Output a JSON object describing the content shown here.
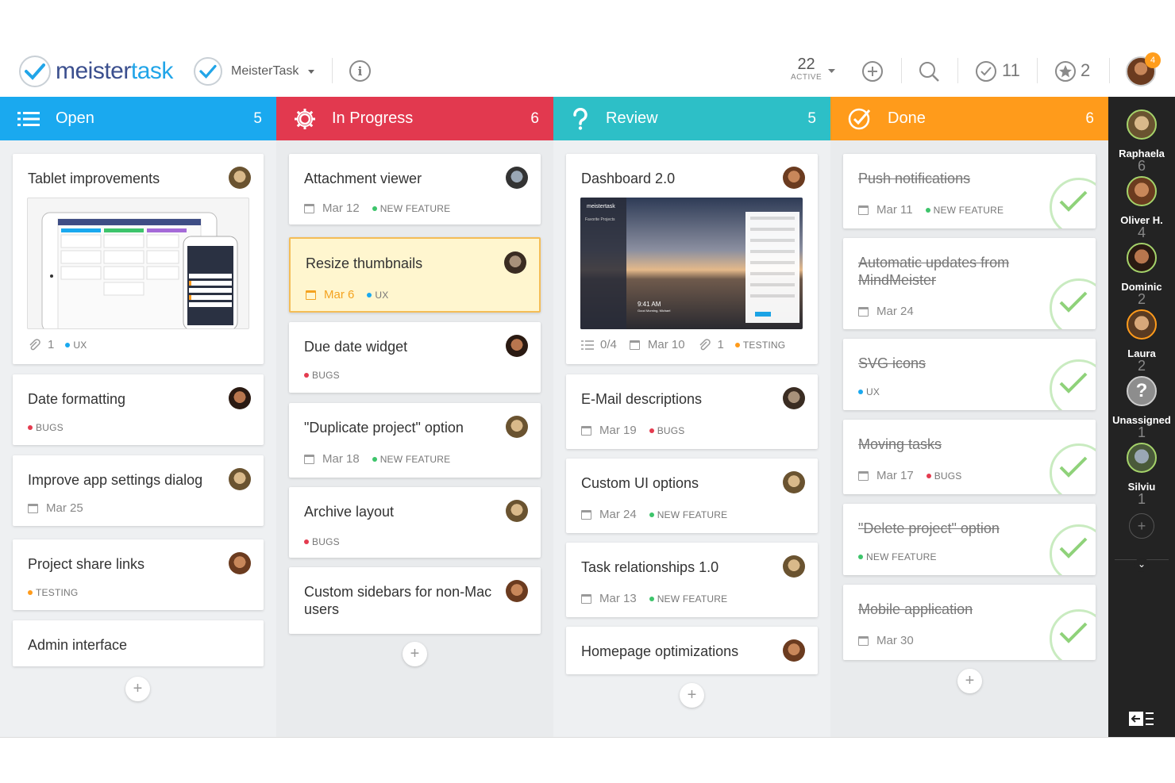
{
  "app": {
    "logo_text_a": "meister",
    "logo_text_b": "task",
    "project_name": "MeisterTask",
    "active_count": "22",
    "active_label": "ACTIVE",
    "checked_count": "11",
    "starred_count": "2",
    "notifications_badge": "4",
    "accent": "#21a5e8"
  },
  "columns": [
    {
      "title": "Open",
      "count": "5",
      "color": "#1aa9ef",
      "icon": "list-icon",
      "cards": [
        {
          "title": "Tablet improvements",
          "attachments": "1",
          "tag": "UX",
          "tag_color": "#1aa9ef"
        },
        {
          "title": "Date formatting",
          "tag": "BUGS",
          "tag_color": "#e43b4f"
        },
        {
          "title": "Improve app settings dialog",
          "date": "Mar 25"
        },
        {
          "title": "Project share links",
          "tag": "TESTING",
          "tag_color": "#ff9b1b"
        },
        {
          "title": "Admin interface"
        }
      ]
    },
    {
      "title": "In Progress",
      "count": "6",
      "color": "#e2394f",
      "icon": "gear-icon",
      "cards": [
        {
          "title": "Attachment viewer",
          "date": "Mar 12",
          "tag": "NEW FEATURE",
          "tag_color": "#3dc46b"
        },
        {
          "title": "Resize thumbnails",
          "date": "Mar 6",
          "tag": "UX",
          "tag_color": "#1aa9ef"
        },
        {
          "title": "Due date widget",
          "tag": "BUGS",
          "tag_color": "#e43b4f"
        },
        {
          "title": "\"Duplicate project\" option",
          "date": "Mar 18",
          "tag": "NEW FEATURE",
          "tag_color": "#3dc46b"
        },
        {
          "title": "Archive layout",
          "tag": "BUGS",
          "tag_color": "#e43b4f"
        },
        {
          "title": "Custom sidebars for non-Mac users"
        }
      ]
    },
    {
      "title": "Review",
      "count": "5",
      "color": "#2dbfc7",
      "icon": "question-icon",
      "cards": [
        {
          "title": "Dashboard 2.0",
          "checklist": "0/4",
          "date": "Mar 10",
          "attachments": "1",
          "tag": "TESTING",
          "tag_color": "#ff9b1b",
          "preview_time": "9:41 AM",
          "preview_greeting": "Good Morning, Michael",
          "preview_logo": "meistertask",
          "preview_heading": "Favorite Projects"
        },
        {
          "title": "E-Mail descriptions",
          "date": "Mar 19",
          "tag": "BUGS",
          "tag_color": "#e43b4f"
        },
        {
          "title": "Custom UI options",
          "date": "Mar 24",
          "tag": "NEW FEATURE",
          "tag_color": "#3dc46b"
        },
        {
          "title": "Task relationships 1.0",
          "date": "Mar 13",
          "tag": "NEW FEATURE",
          "tag_color": "#3dc46b"
        },
        {
          "title": "Homepage optimizations"
        }
      ]
    },
    {
      "title": "Done",
      "count": "6",
      "color": "#ff9b1b",
      "icon": "check-circle-icon",
      "cards": [
        {
          "title": "Push notifications",
          "date": "Mar 11",
          "tag": "NEW FEATURE",
          "tag_color": "#3dc46b"
        },
        {
          "title": "Automatic updates from MindMeister",
          "date": "Mar 24"
        },
        {
          "title": "SVG icons",
          "tag": "UX",
          "tag_color": "#1aa9ef"
        },
        {
          "title": "Moving tasks",
          "date": "Mar 17",
          "tag": "BUGS",
          "tag_color": "#e43b4f"
        },
        {
          "title": "\"Delete project\" option",
          "tag": "NEW FEATURE",
          "tag_color": "#3dc46b"
        },
        {
          "title": "Mobile application",
          "date": "Mar 30"
        }
      ]
    }
  ],
  "members": [
    {
      "name": "Raphaela",
      "count": "6"
    },
    {
      "name": "Oliver H.",
      "count": "4"
    },
    {
      "name": "Dominic",
      "count": "2"
    },
    {
      "name": "Laura",
      "count": "2"
    },
    {
      "name": "Unassigned",
      "count": "1"
    },
    {
      "name": "Silviu",
      "count": "1"
    }
  ]
}
